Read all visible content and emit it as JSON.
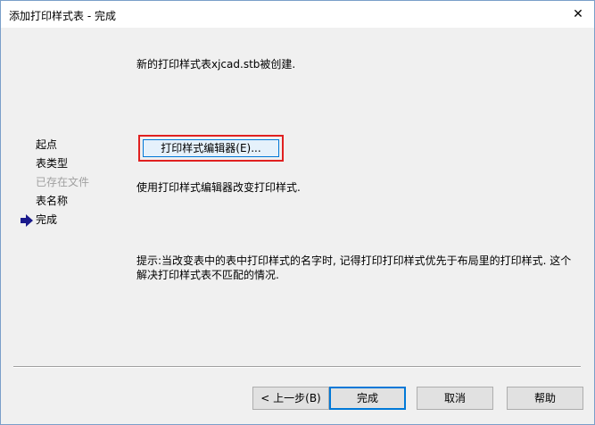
{
  "window": {
    "title": "添加打印样式表 - 完成",
    "close_glyph": "✕"
  },
  "main": {
    "created_message": "新的打印样式表xjcad.stb被创建.",
    "editor_button_label": "打印样式编辑器(E)...",
    "editor_description": "使用打印样式编辑器改变打印样式.",
    "hint": "提示:当改变表中的表中打印样式的名字时, 记得打印打印样式优先于布局里的打印样式. 这个解决打印样式表不匹配的情况."
  },
  "sidebar": {
    "items": [
      {
        "label": "起点",
        "state": "normal"
      },
      {
        "label": "表类型",
        "state": "normal"
      },
      {
        "label": "已存在文件",
        "state": "disabled"
      },
      {
        "label": "表名称",
        "state": "normal"
      },
      {
        "label": "完成",
        "state": "current"
      }
    ],
    "current_indicator_icon": "right-arrow-icon"
  },
  "buttons": {
    "back": "< 上一步(B)",
    "finish": "完成",
    "cancel": "取消",
    "help": "帮助"
  },
  "colors": {
    "highlight_border": "#e02020",
    "accent": "#0078d7",
    "arrow": "#1a1a8c"
  }
}
